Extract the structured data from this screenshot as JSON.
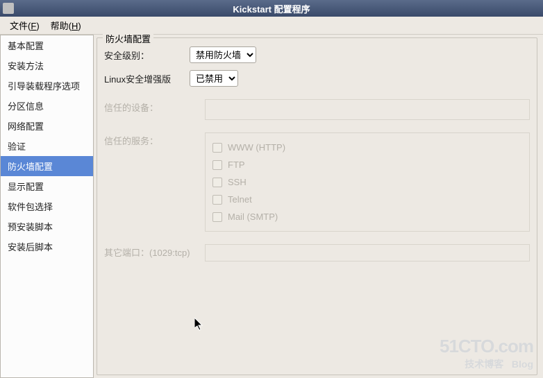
{
  "window": {
    "title": "Kickstart 配置程序"
  },
  "menu": {
    "file": "文件",
    "file_mn": "F",
    "help": "帮助",
    "help_mn": "H"
  },
  "sidebar": {
    "items": [
      {
        "label": "基本配置"
      },
      {
        "label": "安装方法"
      },
      {
        "label": "引导装载程序选项"
      },
      {
        "label": "分区信息"
      },
      {
        "label": "网络配置"
      },
      {
        "label": "验证"
      },
      {
        "label": "防火墙配置"
      },
      {
        "label": "显示配置"
      },
      {
        "label": "软件包选择"
      },
      {
        "label": "预安装脚本"
      },
      {
        "label": "安装后脚本"
      }
    ],
    "selected_index": 6
  },
  "panel": {
    "title": "防火墙配置",
    "security_level_label": "安全级别：",
    "security_level_value": "禁用防火墙",
    "selinux_label": "Linux安全增强版",
    "selinux_value": "已禁用",
    "trusted_devices_label": "信任的设备：",
    "trusted_services_label": "信任的服务：",
    "services": [
      {
        "label": "WWW (HTTP)"
      },
      {
        "label": "FTP"
      },
      {
        "label": "SSH"
      },
      {
        "label": "Telnet"
      },
      {
        "label": "Mail (SMTP)"
      }
    ],
    "other_ports_label": "其它端口：(1029:tcp)",
    "other_ports_value": ""
  },
  "watermark": {
    "top": "51CTO.com",
    "bottom_left": "技术博客",
    "bottom_right": "Blog"
  }
}
